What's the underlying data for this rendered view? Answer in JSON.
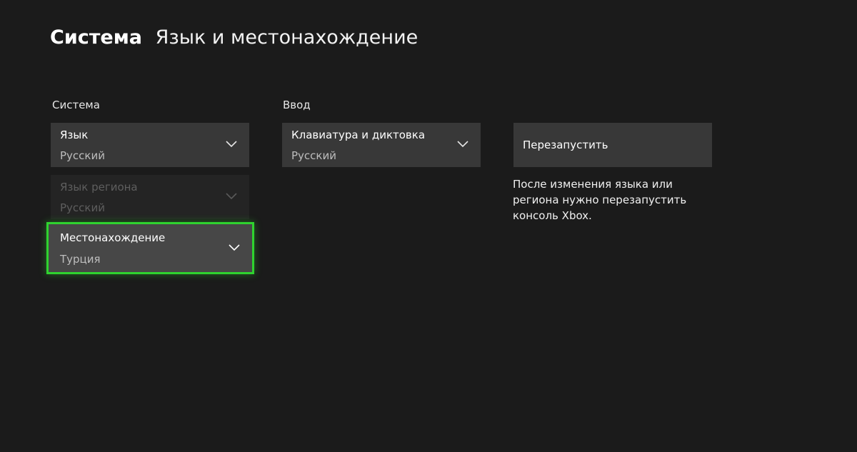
{
  "header": {
    "category": "Система",
    "page_title": "Язык и местонахождение"
  },
  "system": {
    "section_label": "Система",
    "language": {
      "title": "Язык",
      "value": "Русский"
    },
    "region_language": {
      "title": "Язык региона",
      "value": "Русский"
    },
    "location": {
      "title": "Местонахождение",
      "value": "Турция"
    }
  },
  "input": {
    "section_label": "Ввод",
    "keyboard": {
      "title": "Клавиатура и диктовка",
      "value": "Русский"
    }
  },
  "restart": {
    "button_label": "Перезапустить",
    "note": "После изменения языка или региона нужно перезапустить консоль Xbox."
  },
  "icons": {
    "dropdown_chevron": "chevron-down-icon"
  },
  "colors": {
    "background": "#1b1b1b",
    "tile": "#383838",
    "focus_accent": "#2fd32f"
  }
}
